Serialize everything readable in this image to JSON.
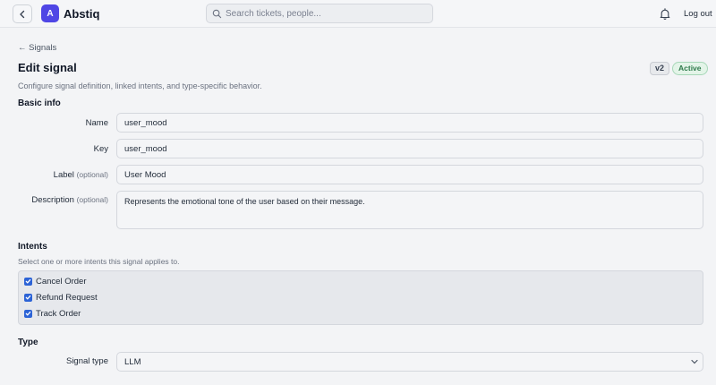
{
  "app": {
    "brand": "Abstiq",
    "logo_letter": "A"
  },
  "header": {
    "search_placeholder": "Search tickets, people...",
    "logout_label": "Log out"
  },
  "breadcrumb": "← Signals",
  "page": {
    "title": "Edit signal",
    "version": "v2",
    "status": "Active",
    "subtitle": "Configure signal definition, linked intents, and type-specific behavior."
  },
  "basic_info": {
    "heading": "Basic info",
    "name_label": "Name",
    "name_value": "user_mood",
    "key_label": "Key",
    "key_value": "user_mood",
    "label_label": "Label",
    "label_optional": "(optional)",
    "label_value": "User Mood",
    "description_label": "Description",
    "description_optional": "(optional)",
    "description_value": "Represents the emotional tone of the user based on their message."
  },
  "intents": {
    "heading": "Intents",
    "hint": "Select one or more intents this signal applies to.",
    "items": [
      {
        "label": "Cancel Order",
        "checked": true
      },
      {
        "label": "Refund Request",
        "checked": true
      },
      {
        "label": "Track Order",
        "checked": true
      }
    ]
  },
  "type": {
    "heading": "Type",
    "signal_type_label": "Signal type",
    "signal_type_value": "LLM"
  },
  "colors": {
    "accent": "#4f46e5",
    "checkbox": "#2c63d6",
    "active_badge": "#2f7a4b"
  }
}
